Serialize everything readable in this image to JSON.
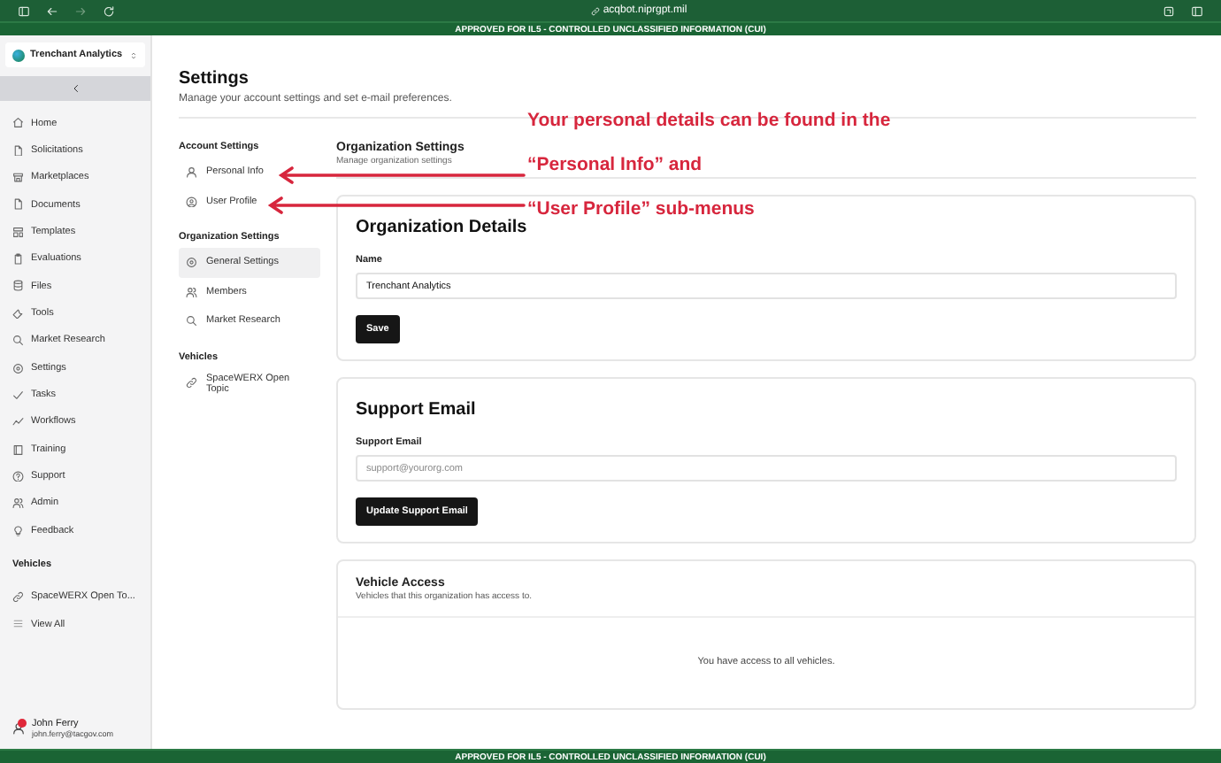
{
  "browser": {
    "url": "acqbot.niprgpt.mil"
  },
  "banner_top": "APPROVED FOR IL5 - CONTROLLED UNCLASSIFIED INFORMATION (CUI)",
  "sidebar": {
    "org": "Trenchant Analytics",
    "items": [
      {
        "label": "Home"
      },
      {
        "label": "Solicitations"
      },
      {
        "label": "Marketplaces"
      },
      {
        "label": "Documents"
      },
      {
        "label": "Templates"
      },
      {
        "label": "Evaluations"
      },
      {
        "label": "Files"
      },
      {
        "label": "Tools"
      },
      {
        "label": "Market Research"
      },
      {
        "label": "Settings"
      },
      {
        "label": "Tasks"
      },
      {
        "label": "Workflows"
      },
      {
        "label": "Training"
      },
      {
        "label": "Support"
      },
      {
        "label": "Admin"
      },
      {
        "label": "Feedback"
      }
    ],
    "section": "Vehicles",
    "vehicle_items": [
      {
        "label": "SpaceWERX Open To..."
      },
      {
        "label": "View All"
      }
    ],
    "user": {
      "name": "John Ferry",
      "email": "john.ferry@tacgov.com"
    }
  },
  "page": {
    "title": "Settings",
    "subtitle": "Manage your account settings and set e-mail preferences."
  },
  "subnav": [
    {
      "heading": "Account Settings",
      "items": [
        {
          "label": "Personal Info",
          "selected": false
        },
        {
          "label": "User Profile",
          "selected": false
        }
      ]
    },
    {
      "heading": "Organization Settings",
      "items": [
        {
          "label": "General Settings",
          "selected": true
        },
        {
          "label": "Members",
          "selected": false
        },
        {
          "label": "Market Research",
          "selected": false
        }
      ]
    },
    {
      "heading": "Vehicles",
      "items": [
        {
          "label": "SpaceWERX Open Topic",
          "selected": false
        }
      ]
    }
  ],
  "section": {
    "title": "Organization Settings",
    "subtitle": "Manage organization settings"
  },
  "cards": [
    {
      "kind": "form",
      "title": "Organization Details",
      "label": "Name",
      "value": "Trenchant Analytics",
      "button": "Save"
    },
    {
      "kind": "form",
      "title": "Support Email",
      "label": "Support Email",
      "placeholder": "support@yourorg.com",
      "button": "Update Support Email"
    },
    {
      "kind": "list",
      "title": "Vehicle Access",
      "subtitle": "Vehicles that this organization has access to.",
      "empty_text": "You have access to all vehicles."
    }
  ],
  "annotation": {
    "lines": [
      "Your personal details can be found in the",
      "“Personal Info” and",
      "“User Profile” sub-menus"
    ]
  },
  "banner_bottom": "APPROVED FOR IL5 - CONTROLLED UNCLASSIFIED INFORMATION (CUI)"
}
